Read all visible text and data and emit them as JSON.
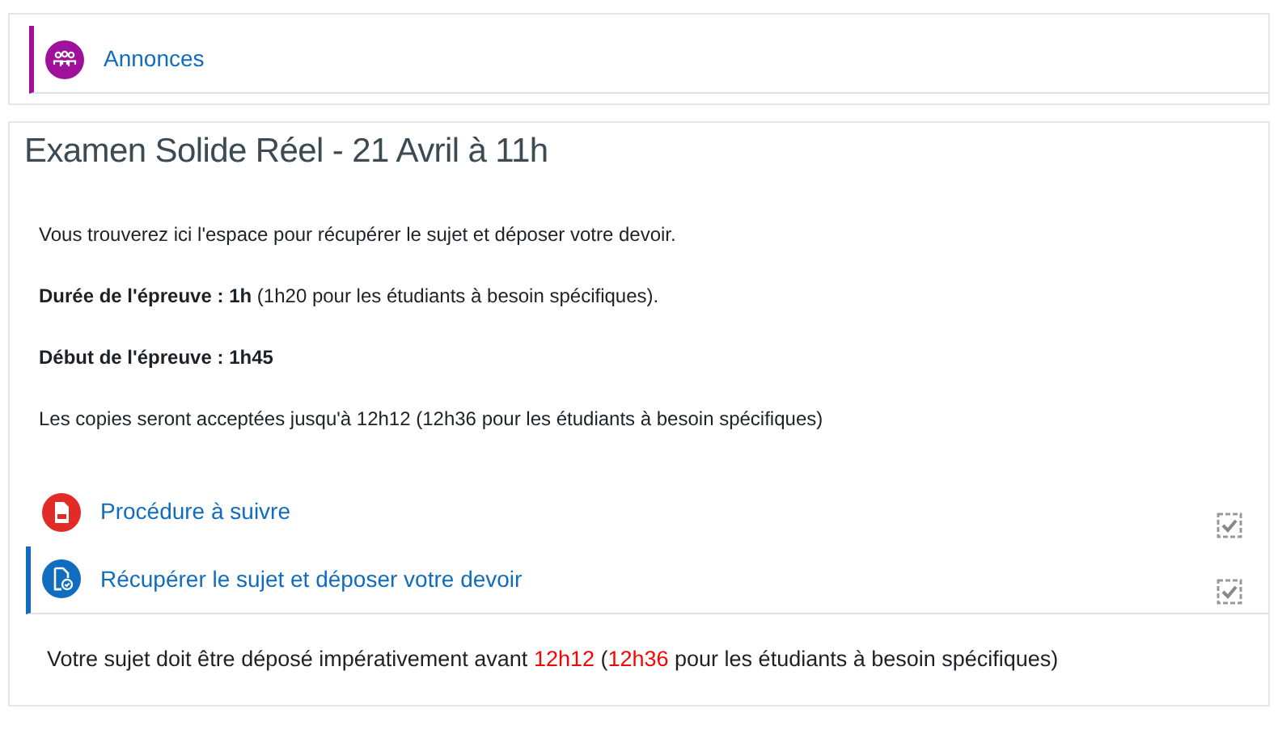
{
  "sections": [
    {
      "activities": [
        {
          "kind": "forum",
          "label": "Annonces"
        }
      ]
    },
    {
      "title": "Examen Solide Réel - 21 Avril à 11h",
      "paragraphs": [
        "Vous trouverez ici l'espace pour récupérer le sujet et déposer votre devoir.",
        "**Durée de l'épreuve :** **1h** (1h20 pour les étudiants à besoin spécifiques).",
        "**Début de l'épreuve :** **1h45**",
        "Les copies seront acceptées jusqu'à 12h12 (12h36 pour les étudiants à besoin spécifiques)"
      ],
      "activities": [
        {
          "kind": "pdf",
          "label": "Procédure à suivre",
          "completed": true
        },
        {
          "kind": "assign",
          "label": "Récupérer le sujet et déposer votre devoir",
          "completed": true
        }
      ],
      "notice": [
        {
          "text": "Votre sujet doit être déposé impérativement avant ",
          "highlighted": false
        },
        {
          "text": "12h12",
          "highlighted": true
        },
        {
          "text": " (",
          "highlighted": false
        },
        {
          "text": "12h36",
          "highlighted": true
        },
        {
          "text": " pour les étudiants à besoin spécifiques)",
          "highlighted": false
        }
      ]
    }
  ]
}
